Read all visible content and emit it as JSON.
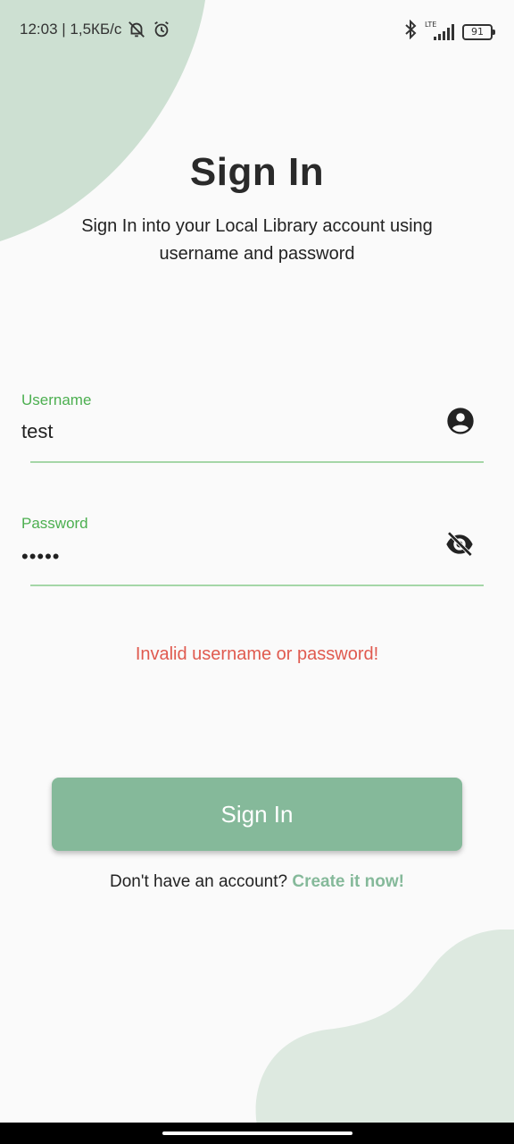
{
  "status_bar": {
    "time_and_speed": "12:03 | 1,5КБ/с",
    "network_label": "LTE",
    "battery": "91"
  },
  "header": {
    "title": "Sign In",
    "subtitle": "Sign In into your Local Library account using username and password"
  },
  "form": {
    "username": {
      "label": "Username",
      "value": "test",
      "icon": "account-circle-icon"
    },
    "password": {
      "label": "Password",
      "value": "•••••",
      "icon": "visibility-off-icon"
    },
    "error": "Invalid username or password!",
    "submit_label": "Sign In"
  },
  "footer": {
    "prompt": "Don't have an account?",
    "link": "Create it now!"
  },
  "colors": {
    "accent_green": "#4caf50",
    "button_green": "#85b99a",
    "error_red": "#e05a4f",
    "blob_top": "#cde0d2",
    "blob_bottom": "#dde9e0"
  }
}
